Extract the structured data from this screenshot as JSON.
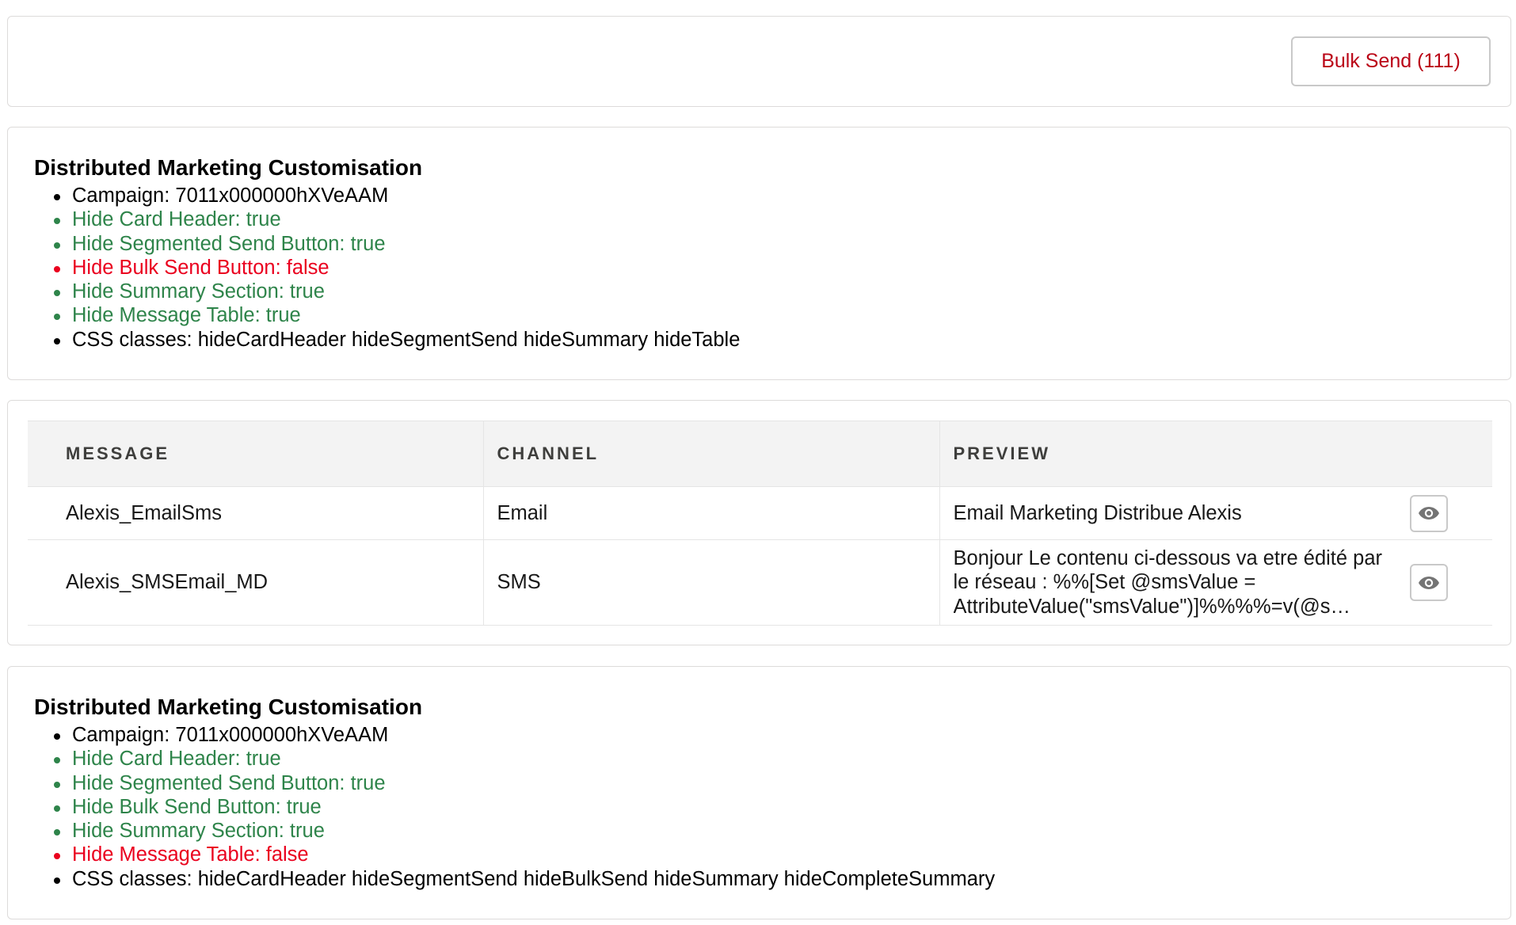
{
  "bulk_send": {
    "label": "Bulk Send (111)"
  },
  "info_top": {
    "title": "Distributed Marketing Customisation",
    "items": [
      {
        "text": "Campaign: 7011x000000hXVeAAM",
        "status": "neutral"
      },
      {
        "text": "Hide Card Header: true",
        "status": "ok"
      },
      {
        "text": "Hide Segmented Send Button: true",
        "status": "ok"
      },
      {
        "text": "Hide Bulk Send Button: false",
        "status": "bad"
      },
      {
        "text": "Hide Summary Section: true",
        "status": "ok"
      },
      {
        "text": "Hide Message Table: true",
        "status": "ok"
      },
      {
        "text": "CSS classes: hideCardHeader hideSegmentSend hideSummary hideTable",
        "status": "neutral"
      }
    ]
  },
  "table": {
    "headers": {
      "message": "MESSAGE",
      "channel": "CHANNEL",
      "preview": "PREVIEW"
    },
    "rows": [
      {
        "message": "Alexis_EmailSms",
        "channel": "Email",
        "preview": "Email Marketing Distribue Alexis",
        "preview_icon": "eye-icon"
      },
      {
        "message": "Alexis_SMSEmail_MD",
        "channel": "SMS",
        "preview": "Bonjour Le contenu ci-dessous va etre édité par le réseau : %%[Set @smsValue = AttributeValue(\"smsValue\")]%%%%=v(@s…",
        "preview_icon": "eye-icon"
      }
    ]
  },
  "info_bottom": {
    "title": "Distributed Marketing Customisation",
    "items": [
      {
        "text": "Campaign: 7011x000000hXVeAAM",
        "status": "neutral"
      },
      {
        "text": "Hide Card Header: true",
        "status": "ok"
      },
      {
        "text": "Hide Segmented Send Button: true",
        "status": "ok"
      },
      {
        "text": "Hide Bulk Send Button: true",
        "status": "ok"
      },
      {
        "text": "Hide Summary Section: true",
        "status": "ok"
      },
      {
        "text": "Hide Message Table: false",
        "status": "bad"
      },
      {
        "text": "CSS classes: hideCardHeader hideSegmentSend hideBulkSend hideSummary hideCompleteSummary",
        "status": "neutral"
      }
    ]
  },
  "colors": {
    "ok": "#2e844a",
    "bad": "#ea001e",
    "brand_destructive": "#ba0517"
  }
}
